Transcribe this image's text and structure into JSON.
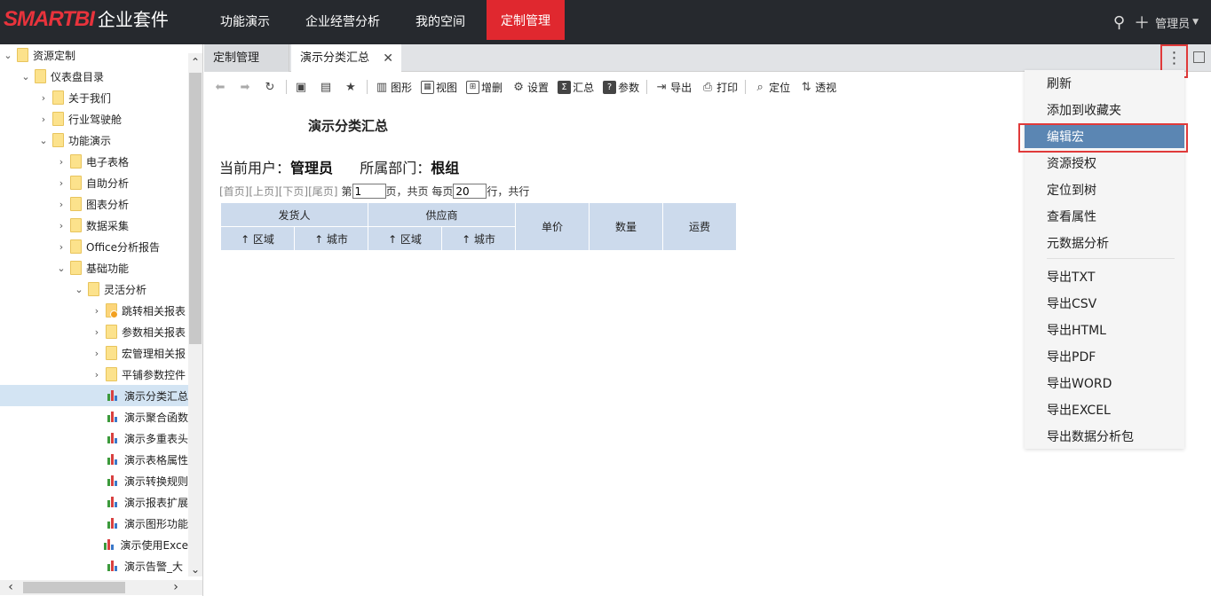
{
  "app": {
    "brand": "SMARTBI",
    "suite": "企业套件"
  },
  "nav": [
    {
      "label": "功能演示"
    },
    {
      "label": "企业经营分析"
    },
    {
      "label": "我的空间"
    },
    {
      "label": "定制管理",
      "active": true
    }
  ],
  "top_right": {
    "search_icon": "search-icon",
    "add_icon": "plus-icon",
    "user": "管理员"
  },
  "tree": [
    {
      "label": "资源定制",
      "depth": 0,
      "expanded": true,
      "kind": "folder"
    },
    {
      "label": "仪表盘目录",
      "depth": 1,
      "expanded": true,
      "kind": "folder"
    },
    {
      "label": "关于我们",
      "depth": 2,
      "expanded": false,
      "kind": "folder"
    },
    {
      "label": "行业驾驶舱",
      "depth": 2,
      "expanded": false,
      "kind": "folder"
    },
    {
      "label": "功能演示",
      "depth": 2,
      "expanded": true,
      "kind": "folder"
    },
    {
      "label": "电子表格",
      "depth": 3,
      "expanded": false,
      "kind": "folder"
    },
    {
      "label": "自助分析",
      "depth": 3,
      "expanded": false,
      "kind": "folder"
    },
    {
      "label": "图表分析",
      "depth": 3,
      "expanded": false,
      "kind": "folder"
    },
    {
      "label": "数据采集",
      "depth": 3,
      "expanded": false,
      "kind": "folder"
    },
    {
      "label": "Office分析报告",
      "depth": 3,
      "expanded": false,
      "kind": "folder"
    },
    {
      "label": "基础功能",
      "depth": 3,
      "expanded": true,
      "kind": "folder"
    },
    {
      "label": "灵活分析",
      "depth": 4,
      "expanded": true,
      "kind": "folder"
    },
    {
      "label": "跳转相关报表",
      "depth": 5,
      "expanded": false,
      "kind": "folder-special"
    },
    {
      "label": "参数相关报表",
      "depth": 5,
      "expanded": false,
      "kind": "folder"
    },
    {
      "label": "宏管理相关报",
      "depth": 5,
      "expanded": false,
      "kind": "folder"
    },
    {
      "label": "平铺参数控件",
      "depth": 5,
      "expanded": false,
      "kind": "folder"
    },
    {
      "label": "演示分类汇总",
      "depth": 5,
      "kind": "report",
      "selected": true
    },
    {
      "label": "演示聚合函数",
      "depth": 5,
      "kind": "report"
    },
    {
      "label": "演示多重表头",
      "depth": 5,
      "kind": "report"
    },
    {
      "label": "演示表格属性",
      "depth": 5,
      "kind": "report"
    },
    {
      "label": "演示转换规则",
      "depth": 5,
      "kind": "report"
    },
    {
      "label": "演示报表扩展",
      "depth": 5,
      "kind": "report"
    },
    {
      "label": "演示图形功能",
      "depth": 5,
      "kind": "report"
    },
    {
      "label": "演示使用Exce",
      "depth": 5,
      "kind": "report"
    },
    {
      "label": "演示告警_大",
      "depth": 5,
      "kind": "report"
    }
  ],
  "tabs": [
    {
      "label": "定制管理"
    },
    {
      "label": "演示分类汇总",
      "close": "✕"
    }
  ],
  "tab_more": "⋮",
  "toolbar": [
    {
      "label": "",
      "icon": "back-icon",
      "glyph": "⬅",
      "dim": true
    },
    {
      "label": "",
      "icon": "forward-icon",
      "glyph": "➡",
      "dim": true
    },
    {
      "label": "",
      "icon": "refresh-icon",
      "glyph": "↻"
    },
    {
      "sep": true
    },
    {
      "label": "",
      "icon": "save-icon",
      "glyph": "▣"
    },
    {
      "label": "",
      "icon": "save-as-icon",
      "glyph": "▤"
    },
    {
      "label": "",
      "icon": "favorite-icon",
      "glyph": "★"
    },
    {
      "sep": true
    },
    {
      "label": "图形",
      "icon": "chart-icon",
      "glyph": "▥"
    },
    {
      "label": "视图",
      "icon": "view-icon",
      "glyph": "▦",
      "box": true
    },
    {
      "label": "增删",
      "icon": "add-remove-icon",
      "glyph": "⊞",
      "box": true
    },
    {
      "label": "设置",
      "icon": "settings-icon",
      "glyph": "⚙"
    },
    {
      "label": "汇总",
      "icon": "sum-icon",
      "glyph": "Σ",
      "dark": true
    },
    {
      "label": "参数",
      "icon": "param-icon",
      "glyph": "?",
      "dark": true
    },
    {
      "sep": true
    },
    {
      "label": "导出",
      "icon": "export-icon",
      "glyph": "⇥"
    },
    {
      "label": "打印",
      "icon": "print-icon",
      "glyph": "⎙"
    },
    {
      "sep": true
    },
    {
      "label": "定位",
      "icon": "locate-icon",
      "glyph": "⌕"
    },
    {
      "label": "透视",
      "icon": "pivot-icon",
      "glyph": "⇅"
    }
  ],
  "report": {
    "title": "演示分类汇总",
    "user_label": "当前用户：",
    "user_value": "管理员",
    "dept_label": "所属部门：",
    "dept_value": "根组",
    "pager": {
      "first": "[首页]",
      "prev": "[上页]",
      "next": "[下页]",
      "last": "[尾页]",
      "page_prefix": "第",
      "page_value": "1",
      "page_suffix": "页，共页 每页",
      "size_value": "20",
      "size_suffix": "行，共行"
    },
    "header": {
      "shipper": "发货人",
      "supplier": "供应商",
      "region": "↑ 区域",
      "city": "↑ 城市",
      "price": "单价",
      "qty": "数量",
      "freight": "运费"
    }
  },
  "menu": [
    {
      "label": "刷新"
    },
    {
      "label": "添加到收藏夹"
    },
    {
      "label": "编辑宏",
      "highlighted": true
    },
    {
      "label": "资源授权"
    },
    {
      "label": "定位到树"
    },
    {
      "label": "查看属性"
    },
    {
      "label": "元数据分析"
    },
    {
      "label": "导出TXT"
    },
    {
      "label": "导出CSV"
    },
    {
      "label": "导出HTML"
    },
    {
      "label": "导出PDF"
    },
    {
      "label": "导出WORD"
    },
    {
      "label": "导出EXCEL"
    },
    {
      "label": "导出数据分析包"
    }
  ],
  "colors": {
    "topbar": "#26292e",
    "brand": "#e8333c",
    "active_nav": "#e0282f",
    "menu_highlight": "#5b86b3",
    "table_header": "#ccdaec",
    "selected_row": "#d3e4f3",
    "callout": "#e03a3a"
  }
}
